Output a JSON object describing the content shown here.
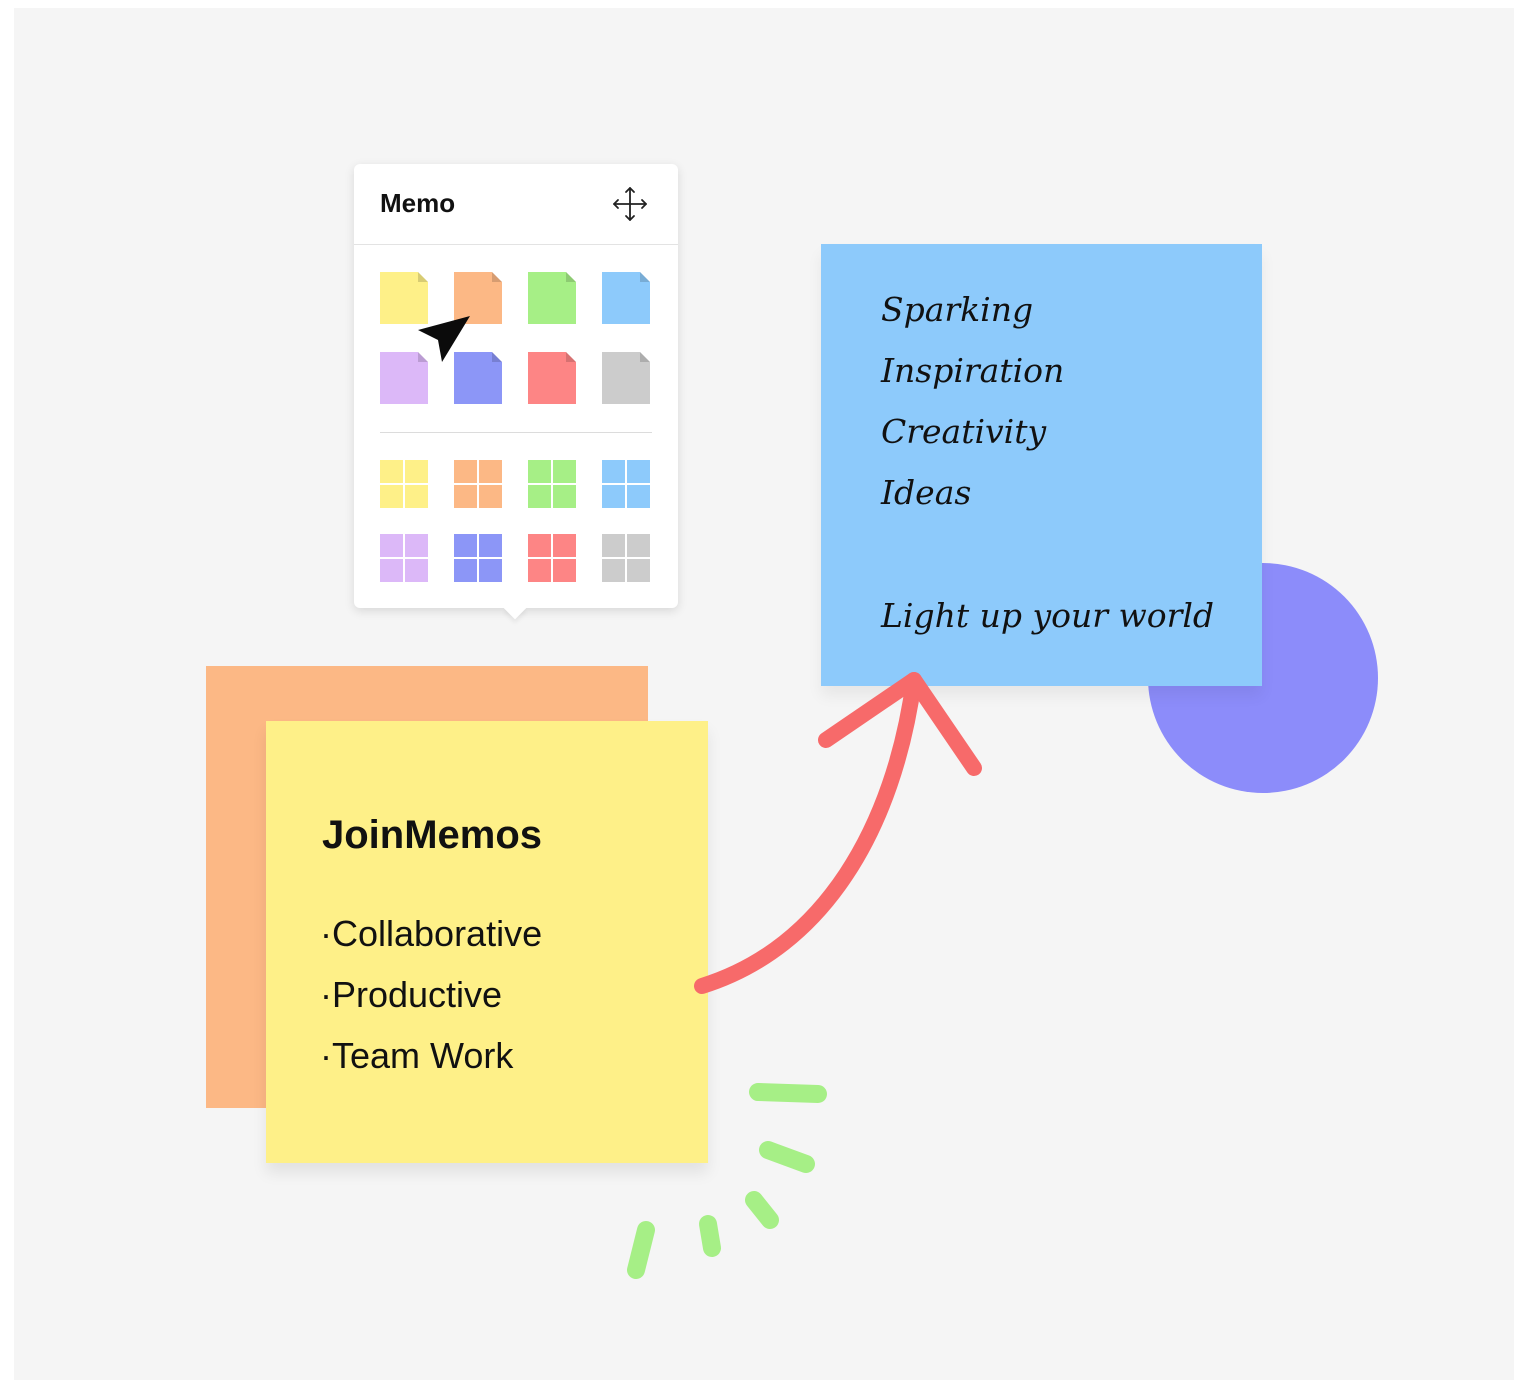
{
  "memo_panel": {
    "title": "Memo",
    "move_icon": "move-arrows-icon",
    "single_notes": [
      {
        "name": "yellow",
        "color": "#fef088"
      },
      {
        "name": "orange",
        "color": "#fcb885"
      },
      {
        "name": "green",
        "color": "#a6ef86"
      },
      {
        "name": "blue",
        "color": "#8dcafb"
      },
      {
        "name": "lilac",
        "color": "#dcb8f8"
      },
      {
        "name": "periwinkle",
        "color": "#8c96f7"
      },
      {
        "name": "red",
        "color": "#fd8585"
      },
      {
        "name": "gray",
        "color": "#cccccc"
      }
    ],
    "grid_notes": [
      {
        "name": "yellow",
        "color": "#fef088"
      },
      {
        "name": "orange",
        "color": "#fcb885"
      },
      {
        "name": "green",
        "color": "#a6ef86"
      },
      {
        "name": "blue",
        "color": "#8dcafb"
      },
      {
        "name": "lilac",
        "color": "#dcb8f8"
      },
      {
        "name": "periwinkle",
        "color": "#8c96f7"
      },
      {
        "name": "red",
        "color": "#fd8585"
      },
      {
        "name": "gray",
        "color": "#cccccc"
      }
    ]
  },
  "cursor_icon": "pointer-arrow-icon",
  "yellow_note": {
    "title": "JoinMemos",
    "items": [
      "·Collaborative",
      "·Productive",
      "·Team Work"
    ]
  },
  "blue_note": {
    "items": [
      "Sparking",
      "Inspiration",
      "Creativity",
      "Ideas"
    ],
    "tagline": "Light up your world"
  },
  "colors": {
    "canvas": "#f5f5f5",
    "arrow": "#f76a6a",
    "sparkle": "#a6ef86",
    "circle": "#8c8cfa"
  }
}
